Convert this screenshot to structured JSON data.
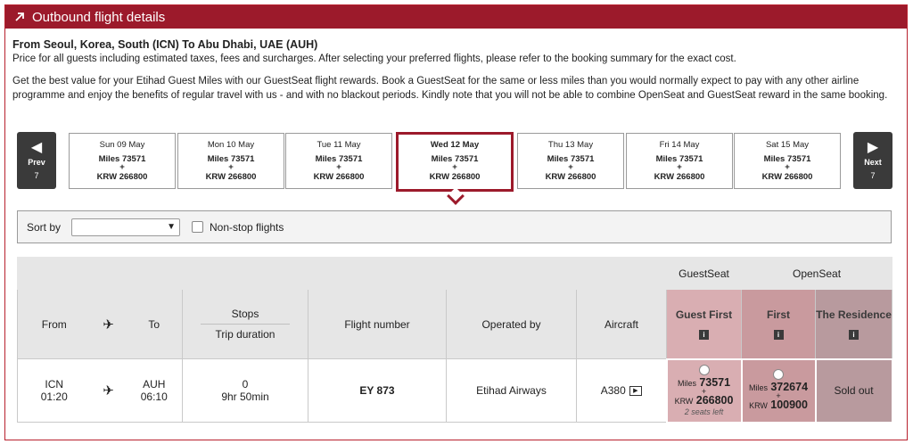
{
  "header": {
    "title": "Outbound flight details"
  },
  "route": "From Seoul, Korea, South (ICN) To Abu Dhabi, UAE (AUH)",
  "price_note": "Price for all guests including estimated taxes, fees and surcharges. After selecting your preferred flights, please refer to the booking summary for the exact cost.",
  "promo": "Get the best value for your Etihad Guest Miles with our GuestSeat flight rewards. Book a GuestSeat for the same or less miles than you would normally expect to pay with any other airline programme and enjoy the benefits of regular travel with us - and with no blackout periods. Kindly note that you will not be able to combine OpenSeat and GuestSeat reward in the same booking.",
  "nav": {
    "prev_label": "Prev",
    "prev_count": "7",
    "next_label": "Next",
    "next_count": "7"
  },
  "days": [
    {
      "date": "Sun 09 May",
      "miles": "Miles 73571",
      "plus": "+",
      "krw": "KRW 266800",
      "selected": false
    },
    {
      "date": "Mon 10 May",
      "miles": "Miles 73571",
      "plus": "+",
      "krw": "KRW 266800",
      "selected": false
    },
    {
      "date": "Tue 11 May",
      "miles": "Miles 73571",
      "plus": "+",
      "krw": "KRW 266800",
      "selected": false
    },
    {
      "date": "Wed 12 May",
      "miles": "Miles 73571",
      "plus": "+",
      "krw": "KRW 266800",
      "selected": true
    },
    {
      "date": "Thu 13 May",
      "miles": "Miles 73571",
      "plus": "+",
      "krw": "KRW 266800",
      "selected": false
    },
    {
      "date": "Fri 14 May",
      "miles": "Miles 73571",
      "plus": "+",
      "krw": "KRW 266800",
      "selected": false
    },
    {
      "date": "Sat 15 May",
      "miles": "Miles 73571",
      "plus": "+",
      "krw": "KRW 266800",
      "selected": false
    }
  ],
  "sort": {
    "label": "Sort by",
    "value": "",
    "nonstop_label": "Non-stop flights",
    "nonstop_checked": false
  },
  "table": {
    "group_guestseat": "GuestSeat",
    "group_openseat": "OpenSeat",
    "headers": {
      "from": "From",
      "to": "To",
      "stops": "Stops",
      "duration": "Trip duration",
      "flight_number": "Flight number",
      "operated_by": "Operated by",
      "aircraft": "Aircraft",
      "guest_first": "Guest First",
      "first": "First",
      "residence": "The Residence"
    },
    "info_glyph": "i",
    "flight": {
      "from_code": "ICN",
      "from_time": "01:20",
      "to_code": "AUH",
      "to_time": "06:10",
      "stops": "0",
      "duration": "9hr 50min",
      "number": "EY 873",
      "operator": "Etihad Airways",
      "aircraft": "A380",
      "guest_first": {
        "miles_label": "Miles",
        "miles": "73571",
        "plus": "+",
        "krw_label": "KRW",
        "krw": "266800",
        "seats": "2 seats left"
      },
      "first": {
        "miles_label": "Miles",
        "miles": "372674",
        "plus": "+",
        "krw_label": "KRW",
        "krw": "100900"
      },
      "residence": "Sold out"
    }
  },
  "icons": {
    "header": "arrow-up-right-icon",
    "plane": "airplane-icon",
    "prev": "chevron-left-icon",
    "next": "chevron-right-icon",
    "info": "info-icon",
    "play": "play-icon"
  },
  "colors": {
    "brand": "#9c1a2b",
    "guest_first": "#d9aeb2",
    "first": "#c99a9e",
    "residence": "#b89a9e"
  }
}
